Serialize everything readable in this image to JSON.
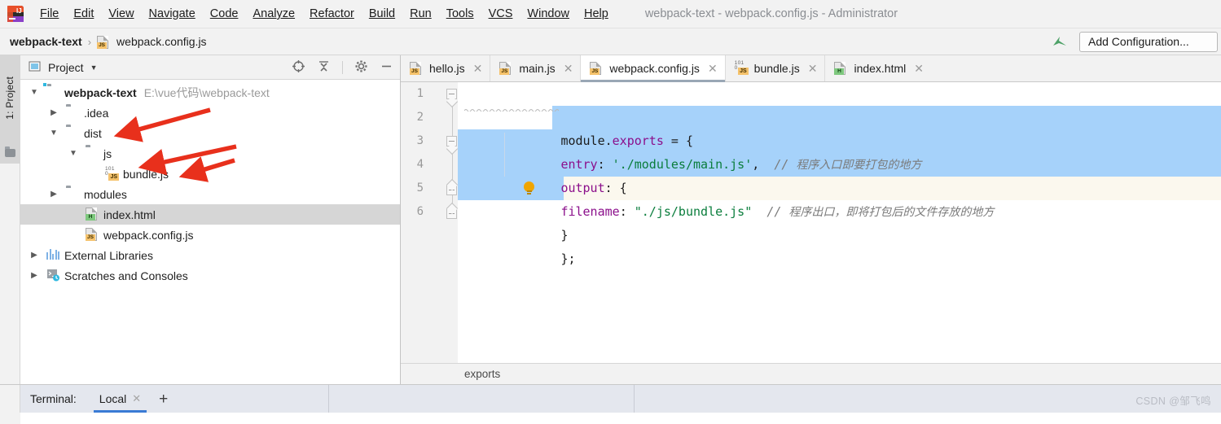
{
  "window": {
    "title": "webpack-text - webpack.config.js - Administrator",
    "logo_icon": "intellij-idea-logo"
  },
  "menubar": {
    "items": [
      {
        "label": "File",
        "mnemonic": "F"
      },
      {
        "label": "Edit",
        "mnemonic": "E"
      },
      {
        "label": "View",
        "mnemonic": "V"
      },
      {
        "label": "Navigate",
        "mnemonic": "N"
      },
      {
        "label": "Code",
        "mnemonic": "C"
      },
      {
        "label": "Analyze",
        "mnemonic": "z"
      },
      {
        "label": "Refactor",
        "mnemonic": "R"
      },
      {
        "label": "Build",
        "mnemonic": "B"
      },
      {
        "label": "Run",
        "mnemonic": "u"
      },
      {
        "label": "Tools",
        "mnemonic": "T"
      },
      {
        "label": "VCS",
        "mnemonic": "S"
      },
      {
        "label": "Window",
        "mnemonic": "W"
      },
      {
        "label": "Help",
        "mnemonic": "H"
      }
    ]
  },
  "navbar": {
    "crumbs": [
      "webpack-text",
      "webpack.config.js"
    ],
    "separator": "›",
    "run_icon": "run-arrow-icon",
    "add_configuration": "Add Configuration..."
  },
  "toolstrip": {
    "project_tab": "1: Project",
    "folder_icon": "folder-icon"
  },
  "project_panel": {
    "title": "Project",
    "caret_icon": "chevron-down-icon",
    "actions": [
      {
        "name": "locate-icon",
        "glyph": "⊕"
      },
      {
        "name": "collapse-all-icon",
        "glyph": "⇵"
      },
      {
        "name": "gear-icon",
        "glyph": "⚙"
      },
      {
        "name": "minimize-icon",
        "glyph": "−"
      }
    ],
    "tree": [
      {
        "indent": 0,
        "twisty": "expanded",
        "icon": "module-folder-icon",
        "label": "webpack-text",
        "bold": true,
        "path": "E:\\vue代码\\webpack-text",
        "selected": false
      },
      {
        "indent": 1,
        "twisty": "collapsed",
        "icon": "folder-icon",
        "label": ".idea",
        "bold": false,
        "path": "",
        "selected": false
      },
      {
        "indent": 1,
        "twisty": "expanded",
        "icon": "folder-icon",
        "label": "dist",
        "bold": false,
        "path": "",
        "selected": false
      },
      {
        "indent": 2,
        "twisty": "expanded",
        "icon": "folder-icon",
        "label": "js",
        "bold": false,
        "path": "",
        "selected": false
      },
      {
        "indent": 3,
        "twisty": "none",
        "icon": "bundled-js-file-icon",
        "label": "bundle.js",
        "bold": false,
        "path": "",
        "selected": false
      },
      {
        "indent": 1,
        "twisty": "collapsed",
        "icon": "folder-icon",
        "label": "modules",
        "bold": false,
        "path": "",
        "selected": false
      },
      {
        "indent": 2,
        "twisty": "none",
        "icon": "html-file-icon",
        "label": "index.html",
        "bold": false,
        "path": "",
        "selected": true
      },
      {
        "indent": 2,
        "twisty": "none",
        "icon": "js-file-icon",
        "label": "webpack.config.js",
        "bold": false,
        "path": "",
        "selected": false
      },
      {
        "indent": 0,
        "twisty": "collapsed",
        "icon": "external-libraries-icon",
        "label": "External Libraries",
        "bold": false,
        "path": "",
        "selected": false
      },
      {
        "indent": 0,
        "twisty": "collapsed",
        "icon": "scratches-icon",
        "label": "Scratches and Consoles",
        "bold": false,
        "path": "",
        "selected": false
      }
    ]
  },
  "editor": {
    "tabs": [
      {
        "label": "hello.js",
        "icon": "js-file-icon",
        "active": false,
        "closable": true
      },
      {
        "label": "main.js",
        "icon": "js-file-icon",
        "active": false,
        "closable": true
      },
      {
        "label": "webpack.config.js",
        "icon": "js-file-icon",
        "active": true,
        "closable": true
      },
      {
        "label": "bundle.js",
        "icon": "bundled-js-file-icon",
        "active": false,
        "closable": true
      },
      {
        "label": "index.html",
        "icon": "html-file-icon",
        "active": false,
        "closable": true
      }
    ],
    "line_numbers": [
      "1",
      "2",
      "3",
      "4",
      "5",
      "6"
    ],
    "code_lines": [
      {
        "n": "1",
        "indent": 0,
        "tokens": [
          {
            "t": "module",
            "c": "plain"
          },
          {
            "t": ".",
            "c": "plain"
          },
          {
            "t": "exports",
            "c": "prop"
          },
          {
            "t": " = {",
            "c": "plain"
          }
        ]
      },
      {
        "n": "2",
        "indent": 1,
        "tokens": [
          {
            "t": "entry",
            "c": "prop"
          },
          {
            "t": ": ",
            "c": "plain"
          },
          {
            "t": "'./modules/main.js'",
            "c": "str"
          },
          {
            "t": ",  ",
            "c": "plain"
          },
          {
            "t": "// ",
            "c": "cmt"
          },
          {
            "t": "程序入口即要打包的地方",
            "c": "cmt-cn"
          }
        ]
      },
      {
        "n": "3",
        "indent": 1,
        "tokens": [
          {
            "t": "output",
            "c": "prop"
          },
          {
            "t": ": {",
            "c": "plain"
          }
        ]
      },
      {
        "n": "4",
        "indent": 2,
        "tokens": [
          {
            "t": "filename",
            "c": "prop"
          },
          {
            "t": ": ",
            "c": "plain"
          },
          {
            "t": "\"./js/bundle.js\"",
            "c": "str"
          },
          {
            "t": "  ",
            "c": "plain"
          },
          {
            "t": "// ",
            "c": "cmt"
          },
          {
            "t": "程序出口，即将打包后的文件存放的地方",
            "c": "cmt-cn"
          }
        ]
      },
      {
        "n": "5",
        "indent": 1,
        "tokens": [
          {
            "t": "}",
            "c": "plain"
          }
        ],
        "bulb": true
      },
      {
        "n": "6",
        "indent": 0,
        "tokens": [
          {
            "t": "};",
            "c": "plain"
          }
        ]
      }
    ],
    "breadcrumb": "exports"
  },
  "terminal": {
    "label": "Terminal:",
    "tabs": [
      {
        "label": "Local",
        "active": true,
        "closable": true
      }
    ],
    "add_icon": "plus-icon"
  },
  "watermark": "CSDN @邹飞鸣",
  "colors": {
    "selection": "#a6d2fa",
    "caret_row": "#fbf8ee",
    "tree_selection": "#d6d6d6",
    "tab_active_underline": "#9aa7b5",
    "terminal_tab_underline": "#3a7bd5",
    "string": "#0a7d3c",
    "property": "#8b0f8b",
    "comment": "#7a7a7a",
    "annotation_arrow": "#e8301c",
    "js_badge": "#f5c26b",
    "html_badge": "#7ec87e",
    "run_arrow": "#4ea268"
  }
}
